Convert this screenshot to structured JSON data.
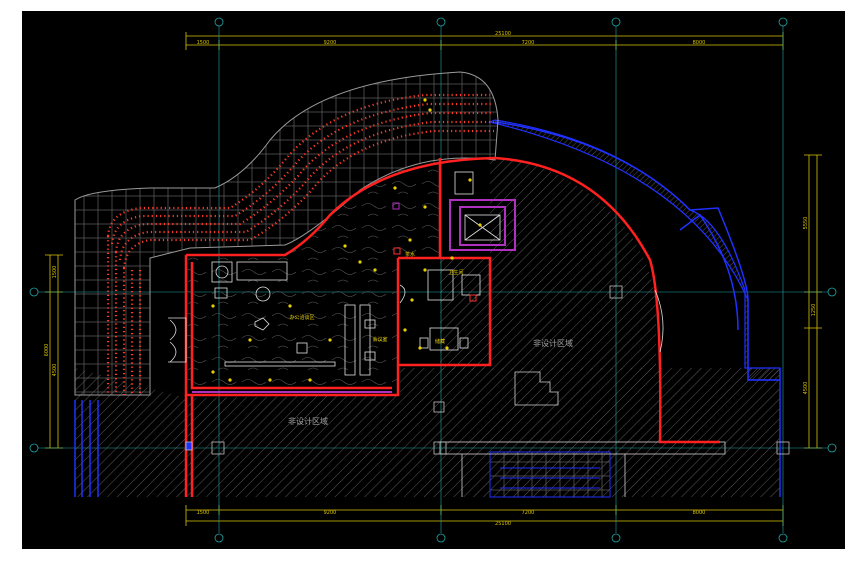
{
  "drawing": {
    "zone_labels": {
      "non_design_center": "非设计区域",
      "non_design_bottom": "非设计区域"
    },
    "room_labels": {
      "office": "办公洽谈区",
      "meeting": "会议室",
      "toilet": "卫生间",
      "storage": "储藏",
      "small_room": "茶水"
    },
    "dims_top": {
      "total": "25100",
      "segments": [
        "1500",
        "9200",
        "7200",
        "8000"
      ]
    },
    "dims_bottom": {
      "total": "25100",
      "segments": [
        "1500",
        "9200",
        "7200",
        "8000"
      ]
    },
    "dims_left": {
      "segments": [
        "1500",
        "4500"
      ],
      "total": "6000"
    },
    "dims_right": {
      "segments": [
        "5550",
        "1250",
        "4500"
      ]
    },
    "colors": {
      "background": "#000000",
      "wall_red": "#ff2020",
      "hatch_gray": "#8a8a8a",
      "dim_yellow": "#d8c400",
      "axis_cyan": "#20a8a8",
      "blue": "#2030ff",
      "magenta": "#b030c0",
      "lights": "#ff4030"
    }
  }
}
